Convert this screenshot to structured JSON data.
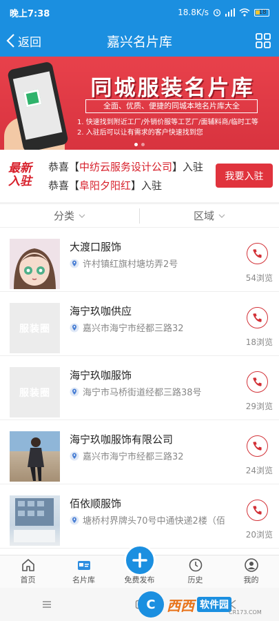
{
  "status_bar": {
    "time": "晚上7:38",
    "speed": "18.8K/s",
    "battery": "18"
  },
  "nav": {
    "back_label": "返回",
    "title": "嘉兴名片库"
  },
  "banner": {
    "title": "同城服装名片库",
    "subtitle": "全面、优质、便捷的同城本地名片库大全",
    "line1": "1. 快速找到附近工厂/外销价服等工艺厂/面辅料商/临时工等",
    "line2": "2. 入驻后可以让有需求的客户快速找到您"
  },
  "news": {
    "logo_line1": "最新",
    "logo_line2": "入驻",
    "prefix": "恭喜【",
    "suffix": "】入驻",
    "items": [
      "中纺云服务设计公司",
      "阜阳夕阳红"
    ],
    "join_label": "我要入驻"
  },
  "filters": {
    "category": "分类",
    "region": "区域"
  },
  "listings": [
    {
      "name": "大渡口服饰",
      "address": "许村镇红旗村塘坊弄2号",
      "views": "54浏览"
    },
    {
      "name": "海宁玖咖供应",
      "address": "嘉兴市海宁市经都三路32",
      "views": "18浏览"
    },
    {
      "name": "海宁玖咖服饰",
      "address": "海宁市马桥街道经都三路38号",
      "views": "29浏览"
    },
    {
      "name": "海宁玖咖服饰有限公司",
      "address": "嘉兴市海宁市经都三路32",
      "views": "24浏览"
    },
    {
      "name": "佰依顺服饰",
      "address": "塘桥村界牌头70号中通快递2楼（佰",
      "views": "20浏览"
    }
  ],
  "placeholder_mark": "服装圈",
  "tabs": [
    "首页",
    "名片库",
    "免费发布",
    "历史",
    "我的"
  ],
  "watermark": {
    "logo": "C",
    "brand": "西西",
    "tag": "软件园",
    "url": "CR173.COM"
  },
  "colors": {
    "primary": "#1b8fe0",
    "accent": "#e0333d"
  }
}
